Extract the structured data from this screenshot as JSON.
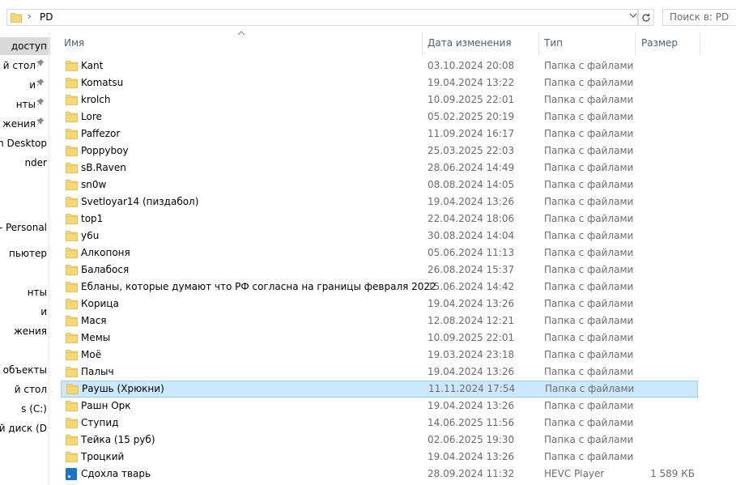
{
  "address": {
    "separator": "›",
    "path": "PD",
    "dropdown_icon": "chevron-down-icon",
    "refresh_icon": "refresh-icon",
    "search_placeholder": "Поиск в: PD"
  },
  "nav": {
    "items": [
      {
        "label": "доступ",
        "pinned": false,
        "selected": true
      },
      {
        "label": "й стол",
        "pinned": true
      },
      {
        "label": "и",
        "pinned": true
      },
      {
        "label": "нты",
        "pinned": true
      },
      {
        "label": "жения",
        "pinned": true
      },
      {
        "label": "n Desktop",
        "pinned": false
      },
      {
        "label": "nder",
        "pinned": false
      },
      {
        "label": "- Personal",
        "pinned": false
      },
      {
        "label": "пьютер",
        "pinned": false
      },
      {
        "label": "нты",
        "pinned": false
      },
      {
        "label": "и",
        "pinned": false
      },
      {
        "label": "жения",
        "pinned": false
      },
      {
        "label": "ые объекты",
        "pinned": false
      },
      {
        "label": "й стол",
        "pinned": false
      },
      {
        "label": "s (C:)",
        "pinned": false
      },
      {
        "label": "ный диск (D",
        "pinned": false
      }
    ]
  },
  "columns": {
    "name": "Имя",
    "date": "Дата изменения",
    "type": "Тип",
    "size": "Размер",
    "sort_icon": "sort-up-icon"
  },
  "colors": {
    "selection_bg": "#cce8ff",
    "selection_border": "#99d1ff",
    "folder_yellow": "#f8d775",
    "header_text": "#4c607a"
  },
  "files": [
    {
      "name": "Kant",
      "date": "03.10.2024 20:08",
      "type": "Папка с файлами",
      "size": "",
      "icon": "folder-icon"
    },
    {
      "name": "Komatsu",
      "date": "19.04.2024 13:22",
      "type": "Папка с файлами",
      "size": "",
      "icon": "folder-icon"
    },
    {
      "name": "krolch",
      "date": "10.09.2025 22:01",
      "type": "Папка с файлами",
      "size": "",
      "icon": "folder-icon"
    },
    {
      "name": "Lore",
      "date": "05.02.2025 20:19",
      "type": "Папка с файлами",
      "size": "",
      "icon": "folder-icon"
    },
    {
      "name": "Paffezor",
      "date": "11.09.2024 16:17",
      "type": "Папка с файлами",
      "size": "",
      "icon": "folder-icon"
    },
    {
      "name": "Poppyboy",
      "date": "25.03.2025 22:03",
      "type": "Папка с файлами",
      "size": "",
      "icon": "folder-icon"
    },
    {
      "name": "sB.Raven",
      "date": "28.06.2024 14:49",
      "type": "Папка с файлами",
      "size": "",
      "icon": "folder-icon"
    },
    {
      "name": "sn0w",
      "date": "08.08.2024 14:05",
      "type": "Папка с файлами",
      "size": "",
      "icon": "folder-icon"
    },
    {
      "name": "Svetloyar14 (пиздабол)",
      "date": "19.04.2024 13:26",
      "type": "Папка с файлами",
      "size": "",
      "icon": "folder-icon"
    },
    {
      "name": "top1",
      "date": "22.04.2024 18:06",
      "type": "Папка с файлами",
      "size": "",
      "icon": "folder-icon"
    },
    {
      "name": "y6u",
      "date": "30.08.2024 14:04",
      "type": "Папка с файлами",
      "size": "",
      "icon": "folder-icon"
    },
    {
      "name": "Алкопоня",
      "date": "05.06.2024 11:13",
      "type": "Папка с файлами",
      "size": "",
      "icon": "folder-icon"
    },
    {
      "name": "Балабося",
      "date": "26.08.2024 15:37",
      "type": "Папка с файлами",
      "size": "",
      "icon": "folder-icon"
    },
    {
      "name": "Еб‌ланы, которые думают что РФ согласна на границы февраля 2022",
      "date": "15.06.2024 14:42",
      "type": "Папка с файлами",
      "size": "",
      "icon": "folder-icon"
    },
    {
      "name": "Корица",
      "date": "19.04.2024 13:26",
      "type": "Папка с файлами",
      "size": "",
      "icon": "folder-icon"
    },
    {
      "name": "Мася",
      "date": "12.08.2024 12:21",
      "type": "Папка с файлами",
      "size": "",
      "icon": "folder-icon"
    },
    {
      "name": "Мемы",
      "date": "10.09.2025 22:01",
      "type": "Папка с файлами",
      "size": "",
      "icon": "folder-icon"
    },
    {
      "name": "Моё",
      "date": "19.03.2024 23:18",
      "type": "Папка с файлами",
      "size": "",
      "icon": "folder-icon"
    },
    {
      "name": "Палыч",
      "date": "19.04.2024 13:26",
      "type": "Папка с файлами",
      "size": "",
      "icon": "folder-icon"
    },
    {
      "name": "Раушь (Хрюкни)",
      "date": "11.11.2024 17:54",
      "type": "Папка с файлами",
      "size": "",
      "icon": "folder-icon",
      "selected": true
    },
    {
      "name": "Рашн Орк",
      "date": "19.04.2024 13:26",
      "type": "Папка с файлами",
      "size": "",
      "icon": "folder-icon"
    },
    {
      "name": "Ступид",
      "date": "14.06.2025 11:56",
      "type": "Папка с файлами",
      "size": "",
      "icon": "folder-icon"
    },
    {
      "name": "Тейка (15 руб)",
      "date": "02.06.2025 19:30",
      "type": "Папка с файлами",
      "size": "",
      "icon": "folder-icon"
    },
    {
      "name": "Троцкий",
      "date": "19.04.2024 13:26",
      "type": "Папка с файлами",
      "size": "",
      "icon": "folder-icon"
    },
    {
      "name": "Сдохла тварь",
      "date": "28.09.2024 11:32",
      "type": "HEVC Player",
      "size": "1 589 КБ",
      "icon": "video-file-icon"
    }
  ]
}
